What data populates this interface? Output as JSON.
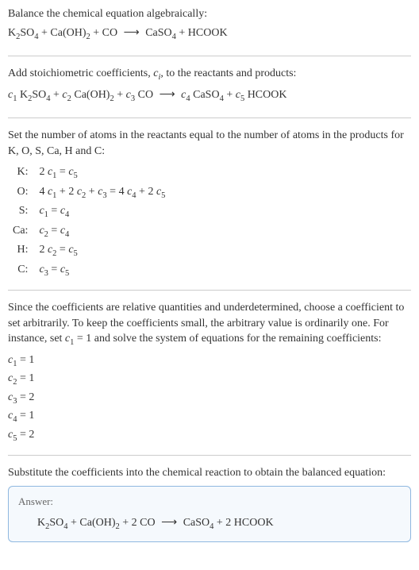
{
  "section1": {
    "intro": "Balance the chemical equation algebraically:",
    "eq_lhs1": "K",
    "eq_lhs1_sub": "2",
    "eq_lhs2": "SO",
    "eq_lhs2_sub": "4",
    "eq_plus1": " + Ca(OH)",
    "eq_caoh_sub": "2",
    "eq_plus2": " + CO ",
    "eq_arrow": "⟶",
    "eq_rhs1": " CaSO",
    "eq_rhs1_sub": "4",
    "eq_plus3": " + HCOOK"
  },
  "section2": {
    "intro_a": "Add stoichiometric coefficients, ",
    "intro_ci": "c",
    "intro_ci_sub": "i",
    "intro_b": ", to the reactants and products:",
    "c1": "c",
    "c1s": "1",
    "sp1": " K",
    "k2": "2",
    "so": "SO",
    "so4": "4",
    "p1": " + ",
    "c2": "c",
    "c2s": "2",
    "sp2": " Ca(OH)",
    "oh2": "2",
    "p2": " + ",
    "c3": "c",
    "c3s": "3",
    "sp3": " CO ",
    "arrow": "⟶",
    "sp4": " ",
    "c4": "c",
    "c4s": "4",
    "sp5": " CaSO",
    "so4b": "4",
    "p3": " + ",
    "c5": "c",
    "c5s": "5",
    "sp6": " HCOOK"
  },
  "section3": {
    "intro": "Set the number of atoms in the reactants equal to the number of atoms in the products for K, O, S, Ca, H and C:",
    "rows": [
      {
        "label": "K:",
        "pre": "2 ",
        "c1": "c",
        "c1s": "1",
        "mid": " = ",
        "c2": "c",
        "c2s": "5",
        "post": ""
      },
      {
        "label": "O:",
        "pre": "4 ",
        "c1": "c",
        "c1s": "1",
        "mid": " + 2 ",
        "c2": "c",
        "c2s": "2",
        "mid2": " + ",
        "c3": "c",
        "c3s": "3",
        "eq": " = 4 ",
        "c4": "c",
        "c4s": "4",
        "mid3": " + 2 ",
        "c5": "c",
        "c5s": "5"
      },
      {
        "label": "S:",
        "pre": "",
        "c1": "c",
        "c1s": "1",
        "mid": " = ",
        "c2": "c",
        "c2s": "4",
        "post": ""
      },
      {
        "label": "Ca:",
        "pre": "",
        "c1": "c",
        "c1s": "2",
        "mid": " = ",
        "c2": "c",
        "c2s": "4",
        "post": ""
      },
      {
        "label": "H:",
        "pre": "2 ",
        "c1": "c",
        "c1s": "2",
        "mid": " = ",
        "c2": "c",
        "c2s": "5",
        "post": ""
      },
      {
        "label": "C:",
        "pre": "",
        "c1": "c",
        "c1s": "3",
        "mid": " = ",
        "c2": "c",
        "c2s": "5",
        "post": ""
      }
    ]
  },
  "section4": {
    "intro_a": "Since the coefficients are relative quantities and underdetermined, choose a coefficient to set arbitrarily. To keep the coefficients small, the arbitrary value is ordinarily one. For instance, set ",
    "c1": "c",
    "c1s": "1",
    "intro_b": " = 1 and solve the system of equations for the remaining coefficients:",
    "coeffs": [
      {
        "c": "c",
        "s": "1",
        "v": " = 1"
      },
      {
        "c": "c",
        "s": "2",
        "v": " = 1"
      },
      {
        "c": "c",
        "s": "3",
        "v": " = 2"
      },
      {
        "c": "c",
        "s": "4",
        "v": " = 1"
      },
      {
        "c": "c",
        "s": "5",
        "v": " = 2"
      }
    ]
  },
  "section5": {
    "intro": "Substitute the coefficients into the chemical reaction to obtain the balanced equation:",
    "answer_label": "Answer:",
    "eq_a": "K",
    "eq_a_sub": "2",
    "eq_b": "SO",
    "eq_b_sub": "4",
    "eq_c": " + Ca(OH)",
    "eq_c_sub": "2",
    "eq_d": " + 2 CO ",
    "arrow": "⟶",
    "eq_e": " CaSO",
    "eq_e_sub": "4",
    "eq_f": " + 2 HCOOK"
  }
}
